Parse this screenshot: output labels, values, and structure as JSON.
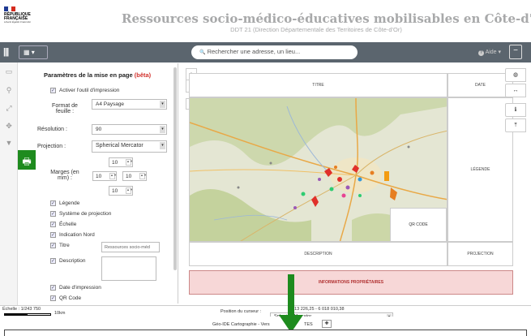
{
  "header": {
    "logo": {
      "line1": "RÉPUBLIQUE",
      "line2": "FRANÇAISE",
      "devise": "Liberté Égalité Fraternité"
    },
    "title": "Ressources socio-médico-éducatives mobilisables en Côte-d'Or",
    "subtitle": "DDT 21 (Direction Départementale des Territoires de Côte-d'Or)"
  },
  "navbar": {
    "menu_icon": "|||",
    "map_button": "▦ ▾",
    "search_placeholder": "Rechercher une adresse, un lieu...",
    "search_icon": "🔍",
    "help_label": "Aide",
    "help_icon": "?",
    "collapse_icon": "−"
  },
  "leftbar": {
    "icons": [
      "map-icon",
      "pin-icon",
      "measure-icon",
      "move-icon",
      "filter-icon"
    ],
    "print_icon": "🖶"
  },
  "panel": {
    "title_main": "Paramètres de la mise en page",
    "title_beta": "(bêta)",
    "activate_label": "Activer l'outil d'impression",
    "format_label_1": "Format de",
    "format_label_2": "feuille :",
    "format_value": "A4 Paysage",
    "resolution_label": "Résolution :",
    "resolution_value": "90",
    "projection_label": "Projection :",
    "projection_value": "Spherical Mercator",
    "margins_label_1": "Marges (en",
    "margins_label_2": "mm) :",
    "margin_top": "10",
    "margin_left": "10",
    "margin_right": "10",
    "margin_bottom": "10",
    "opt_legende": "Légende",
    "opt_systeme": "Système de projection",
    "opt_echelle": "Échelle",
    "opt_nord": "Indication Nord",
    "opt_titre": "Titre",
    "titre_value": "Ressources socio-méd",
    "opt_description": "Description",
    "opt_date": "Date d'impression",
    "opt_qr": "QR Code"
  },
  "layout_preview": {
    "titre": "TITRE",
    "date": "DATE",
    "legende": "LÉGENDE",
    "qr_code": "QR CODE",
    "description": "DESCRIPTION",
    "projection": "PROJECTION",
    "informations": "INFORMATIONS PROPRIÉTAIRES"
  },
  "right_tools": [
    "globe-icon",
    "arrows-icon",
    "info-icon",
    "upload-icon"
  ],
  "footer": {
    "scale_label": "Échelle : 1/243 750",
    "scale_bar_label": "10km",
    "cursor_label": "Position du curseur :",
    "cursor_value": "613 226,25 - 6 018 010,38",
    "projection_select": "Spherical Mercator",
    "credits": "Géo-IDE Cartographie - Vers",
    "credits_end": "TES"
  },
  "colors": {
    "accent": "#1e8b1e",
    "navbar": "#5b656e",
    "warning_bg": "#f7d7d7",
    "warning_text": "#b03030",
    "beta": "#d2322d"
  }
}
